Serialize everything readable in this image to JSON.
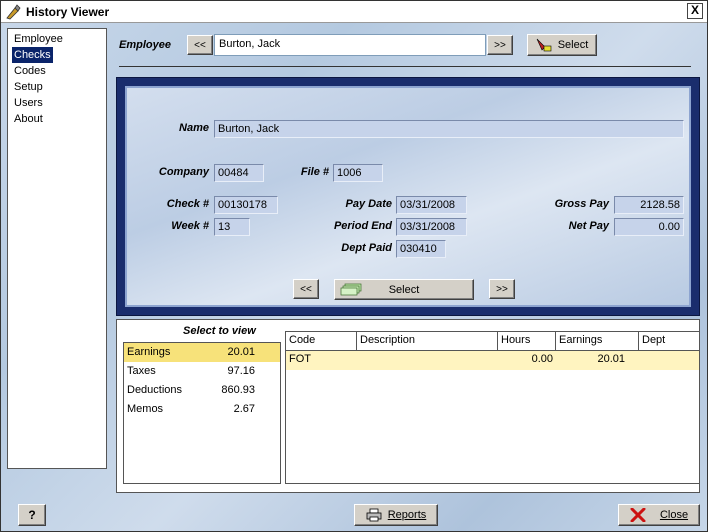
{
  "window": {
    "title": "History Viewer",
    "close_label": "X"
  },
  "nav": {
    "items": [
      "Employee",
      "Checks",
      "Codes",
      "Setup",
      "Users",
      "About"
    ],
    "selected": "Checks"
  },
  "employee_bar": {
    "label": "Employee",
    "prev_label": "<<",
    "next_label": ">>",
    "value": "Burton, Jack",
    "select_label": "Select"
  },
  "check": {
    "name_label": "Name",
    "name": "Burton, Jack",
    "company_label": "Company",
    "company": "00484",
    "file_label": "File #",
    "file": "1006",
    "check_label": "Check #",
    "check_no": "00130178",
    "week_label": "Week #",
    "week": "13",
    "pay_date_label": "Pay Date",
    "pay_date": "03/31/2008",
    "period_end_label": "Period End",
    "period_end": "03/31/2008",
    "dept_paid_label": "Dept Paid",
    "dept_paid": "030410",
    "gross_pay_label": "Gross Pay",
    "gross_pay": "2128.58",
    "net_pay_label": "Net Pay",
    "net_pay": "0.00",
    "prev_label": "<<",
    "select_label": "Select",
    "next_label": ">>"
  },
  "select_to_view": {
    "title": "Select to view",
    "items": [
      {
        "label": "Earnings",
        "value": "20.01"
      },
      {
        "label": "Taxes",
        "value": "97.16"
      },
      {
        "label": "Deductions",
        "value": "860.93"
      },
      {
        "label": "Memos",
        "value": "2.67"
      }
    ],
    "selected": "Earnings"
  },
  "detail_grid": {
    "columns": [
      "Code",
      "Description",
      "Hours",
      "Earnings",
      "Dept"
    ],
    "rows": [
      {
        "code": "FOT",
        "description": "",
        "hours": "0.00",
        "earnings": "20.01",
        "dept": ""
      }
    ]
  },
  "footer": {
    "help_label": "?",
    "reports_label": "Reports",
    "close_label": "Close"
  },
  "colors": {
    "nav_selected": "#0a246a",
    "panel_frame": "#1a2d6d",
    "row_highlight": "#f7e27a",
    "close_icon": "#cc1111"
  }
}
